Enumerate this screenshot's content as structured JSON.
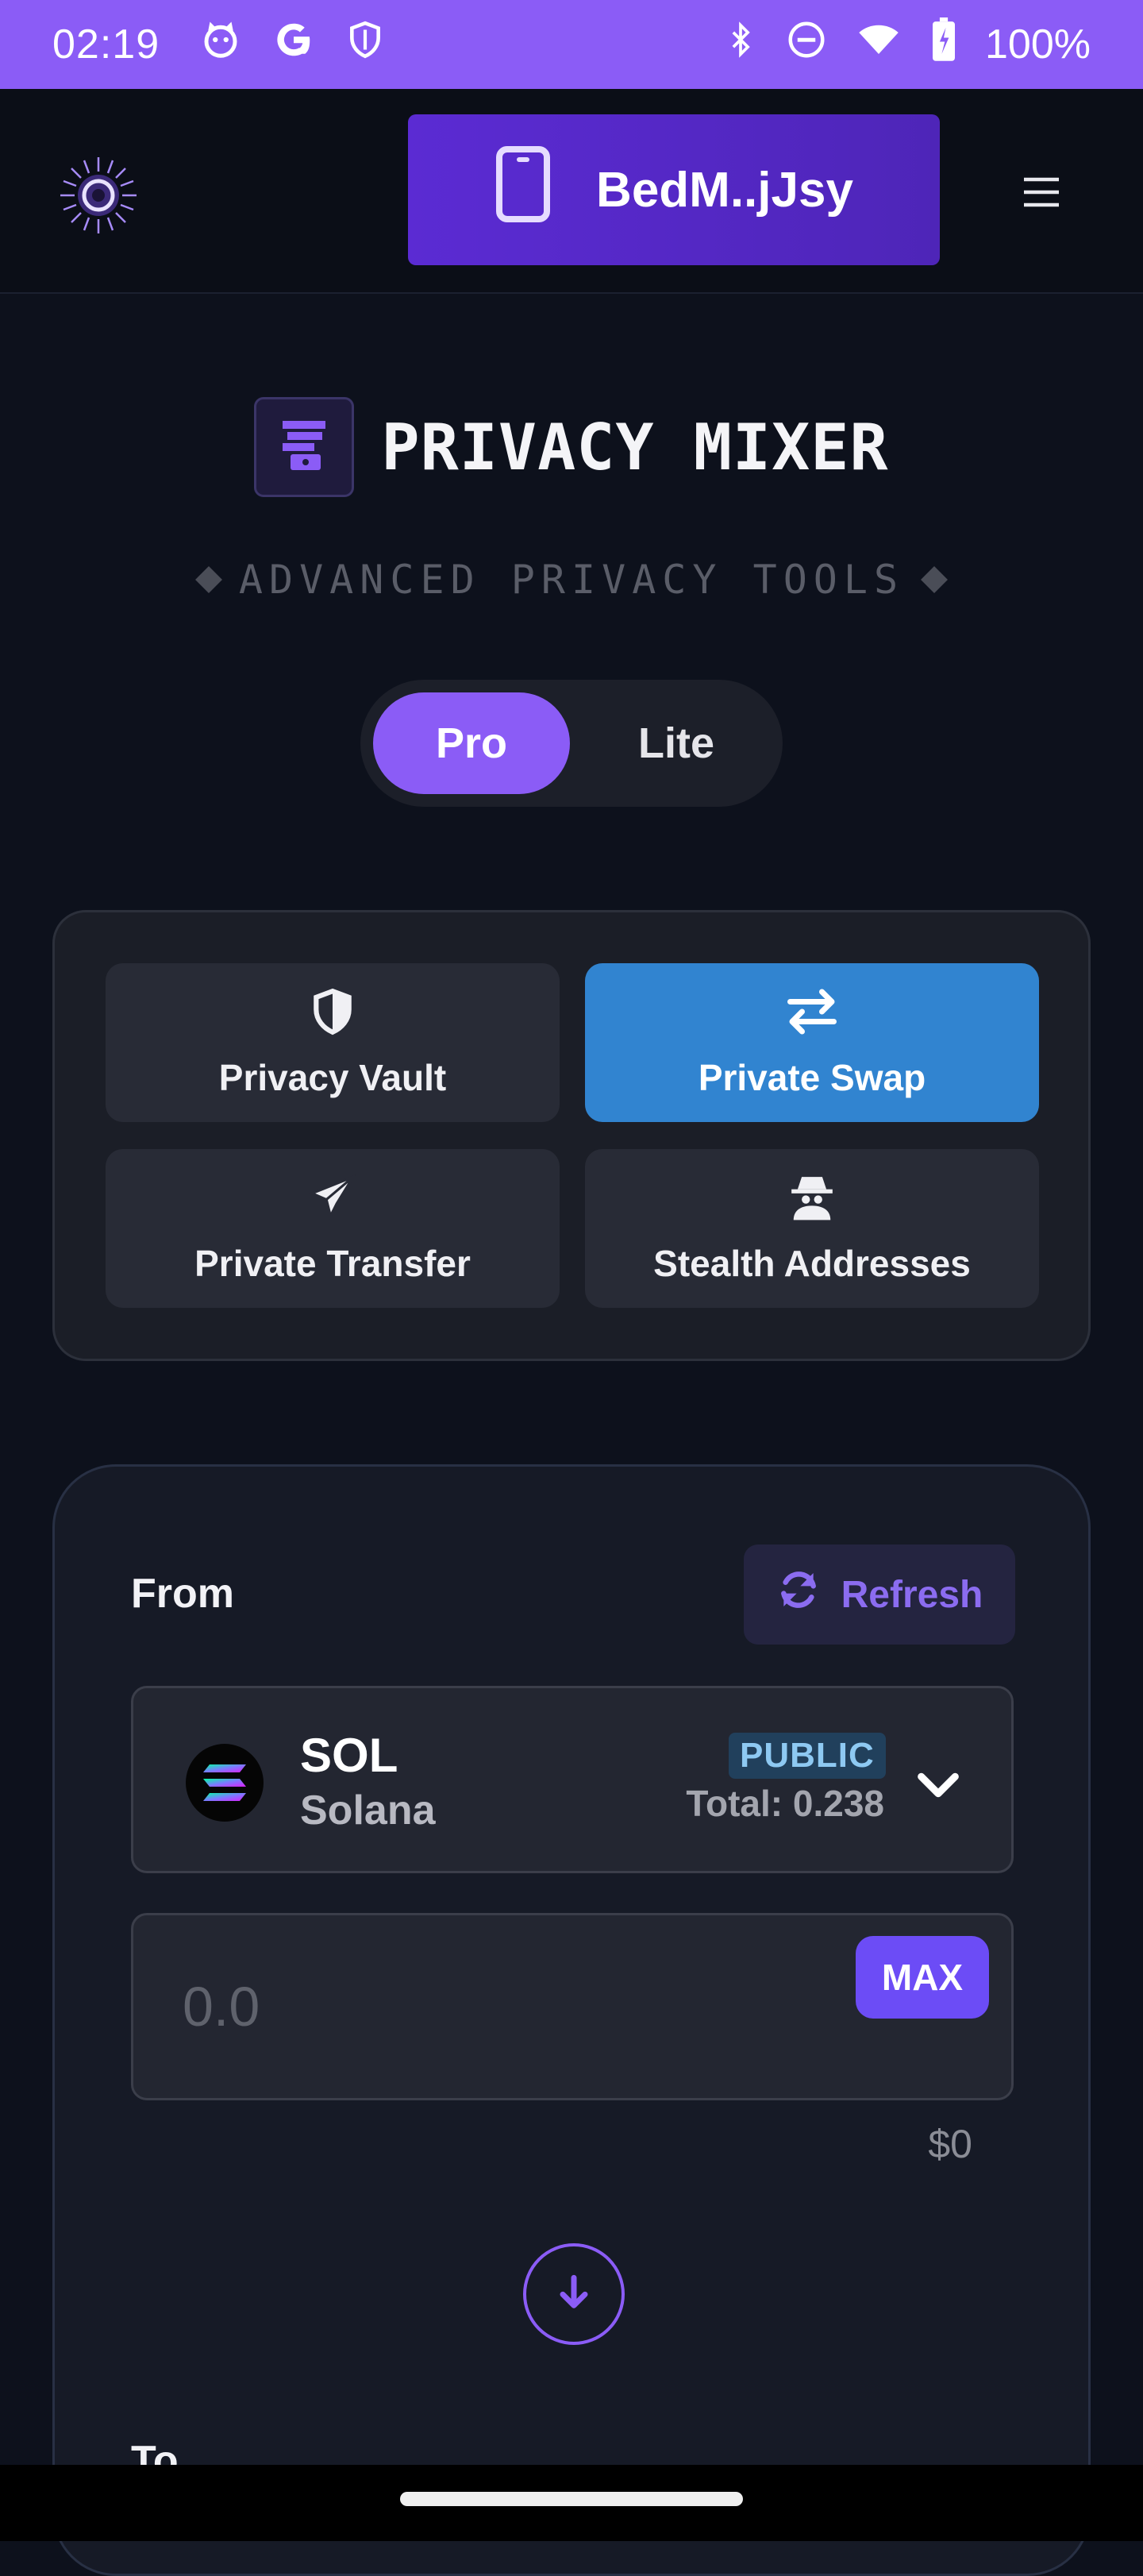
{
  "status_bar": {
    "time": "02:19",
    "battery": "100%",
    "icons": [
      "cat-icon",
      "google-icon",
      "shield-icon",
      "bluetooth-icon",
      "do-not-disturb-icon",
      "wifi-icon",
      "battery-icon"
    ]
  },
  "header": {
    "logo_icon": "sun-logo-icon",
    "wallet_label": "BedM..jJsy",
    "wallet_icon": "phone-icon",
    "menu_icon": "hamburger-menu-icon"
  },
  "title": {
    "text": "PRIVACY MIXER",
    "subtitle": "ADVANCED PRIVACY TOOLS",
    "icon": "mixer-icon"
  },
  "mode_toggle": {
    "options": [
      "Pro",
      "Lite"
    ],
    "selected": "Pro"
  },
  "tools": [
    {
      "label": "Privacy Vault",
      "icon": "shield-half-icon",
      "active": false
    },
    {
      "label": "Private Swap",
      "icon": "swap-arrows-icon",
      "active": true
    },
    {
      "label": "Private Transfer",
      "icon": "paper-plane-icon",
      "active": false
    },
    {
      "label": "Stealth Addresses",
      "icon": "spy-icon",
      "active": false
    }
  ],
  "swap": {
    "from_label": "From",
    "refresh_label": "Refresh",
    "token": {
      "symbol": "SOL",
      "name": "Solana",
      "badge": "PUBLIC",
      "balance": "Total: 0.238"
    },
    "amount_placeholder": "0.0",
    "max_label": "MAX",
    "usd_value": "$0",
    "to_label": "To"
  },
  "colors": {
    "accent": "#8b5cf6",
    "active_tool": "#3184d0",
    "wallet_button": "#5b2bd3",
    "background": "#0d111c"
  }
}
